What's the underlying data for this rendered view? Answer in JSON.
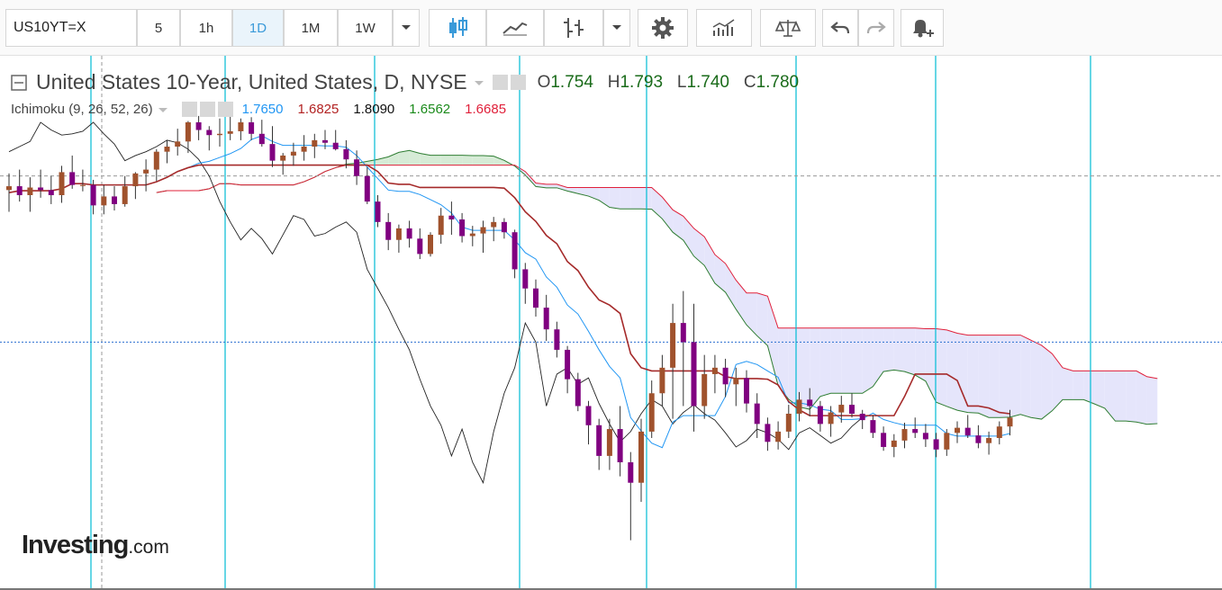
{
  "toolbar": {
    "symbol": "US10YT=X",
    "intervals": [
      {
        "label": "5",
        "active": false
      },
      {
        "label": "1h",
        "active": false
      },
      {
        "label": "1D",
        "active": true
      },
      {
        "label": "1M",
        "active": false
      },
      {
        "label": "1W",
        "active": false
      }
    ],
    "icons": [
      "chevron-down-icon",
      "candlestick-icon",
      "line-chart-icon",
      "bar-style-icon",
      "chevron-down-icon",
      "gear-icon",
      "indicators-icon",
      "compare-scale-icon",
      "undo-icon",
      "redo-icon",
      "alert-icon"
    ]
  },
  "legend": {
    "title": "United States 10-Year, United States, D, NYSE",
    "open_label": "O",
    "open": "1.754",
    "high_label": "H",
    "high": "1.793",
    "low_label": "L",
    "low": "1.740",
    "close_label": "C",
    "close": "1.780"
  },
  "indicator": {
    "name": "Ichimoku (9, 26, 52, 26)",
    "values": [
      "1.7650",
      "1.6825",
      "1.8090",
      "1.6562",
      "1.6685"
    ],
    "colors": [
      "#2196f3",
      "#a52a2a",
      "#111111",
      "#1a8a1a",
      "#e0203a"
    ]
  },
  "brand": {
    "name": "Investing",
    "suffix": ".com"
  },
  "colors": {
    "accent": "#3a9ad9",
    "candle_up": "#a0522d",
    "candle_down": "#800080",
    "tenkan": "#2196f3",
    "kijun": "#a52a2a",
    "chikou": "#222222",
    "span_a": "#2e7d32",
    "span_b": "#e0203a",
    "cloud_bull": "#cfe8cf",
    "cloud_bear": "#e0e0fa",
    "separator": "#00bcd4"
  },
  "chart_data": {
    "type": "candlestick",
    "indicator": "Ichimoku",
    "ylim": [
      1.49,
      1.87
    ],
    "current_price_line": 1.66,
    "crosshair_price": 1.79,
    "separator_count": 8,
    "candles": [
      [
        1.779,
        1.792,
        1.762,
        1.782
      ],
      [
        1.782,
        1.795,
        1.77,
        1.775
      ],
      [
        1.775,
        1.789,
        1.762,
        1.781
      ],
      [
        1.781,
        1.795,
        1.773,
        1.779
      ],
      [
        1.779,
        1.79,
        1.768,
        1.775
      ],
      [
        1.775,
        1.798,
        1.769,
        1.793
      ],
      [
        1.793,
        1.806,
        1.78,
        1.783
      ],
      [
        1.783,
        1.795,
        1.778,
        1.783
      ],
      [
        1.783,
        1.787,
        1.76,
        1.767
      ],
      [
        1.767,
        1.783,
        1.76,
        1.774
      ],
      [
        1.774,
        1.782,
        1.763,
        1.768
      ],
      [
        1.768,
        1.79,
        1.766,
        1.782
      ],
      [
        1.782,
        1.793,
        1.772,
        1.792
      ],
      [
        1.792,
        1.803,
        1.778,
        1.795
      ],
      [
        1.795,
        1.811,
        1.786,
        1.809
      ],
      [
        1.809,
        1.818,
        1.8,
        1.813
      ],
      [
        1.813,
        1.827,
        1.806,
        1.817
      ],
      [
        1.817,
        1.833,
        1.808,
        1.832
      ],
      [
        1.832,
        1.837,
        1.818,
        1.826
      ],
      [
        1.826,
        1.829,
        1.81,
        1.822
      ],
      [
        1.822,
        1.835,
        1.813,
        1.823
      ],
      [
        1.823,
        1.837,
        1.818,
        1.825
      ],
      [
        1.825,
        1.835,
        1.818,
        1.832
      ],
      [
        1.832,
        1.836,
        1.818,
        1.823
      ],
      [
        1.823,
        1.834,
        1.813,
        1.815
      ],
      [
        1.815,
        1.829,
        1.797,
        1.802
      ],
      [
        1.802,
        1.808,
        1.791,
        1.806
      ],
      [
        1.806,
        1.816,
        1.798,
        1.809
      ],
      [
        1.809,
        1.822,
        1.802,
        1.813
      ],
      [
        1.813,
        1.823,
        1.804,
        1.818
      ],
      [
        1.818,
        1.826,
        1.811,
        1.816
      ],
      [
        1.816,
        1.826,
        1.81,
        1.811
      ],
      [
        1.811,
        1.818,
        1.796,
        1.803
      ],
      [
        1.803,
        1.81,
        1.783,
        1.79
      ],
      [
        1.79,
        1.797,
        1.768,
        1.77
      ],
      [
        1.77,
        1.775,
        1.75,
        1.754
      ],
      [
        1.754,
        1.761,
        1.732,
        1.74
      ],
      [
        1.74,
        1.752,
        1.73,
        1.749
      ],
      [
        1.749,
        1.755,
        1.734,
        1.741
      ],
      [
        1.741,
        1.749,
        1.725,
        1.729
      ],
      [
        1.729,
        1.746,
        1.727,
        1.744
      ],
      [
        1.744,
        1.765,
        1.737,
        1.759
      ],
      [
        1.759,
        1.77,
        1.744,
        1.756
      ],
      [
        1.756,
        1.761,
        1.738,
        1.743
      ],
      [
        1.743,
        1.751,
        1.735,
        1.745
      ],
      [
        1.745,
        1.755,
        1.73,
        1.75
      ],
      [
        1.75,
        1.758,
        1.739,
        1.754
      ],
      [
        1.754,
        1.757,
        1.741,
        1.746
      ],
      [
        1.746,
        1.748,
        1.71,
        1.717
      ],
      [
        1.717,
        1.722,
        1.69,
        1.702
      ],
      [
        1.702,
        1.709,
        1.68,
        1.687
      ],
      [
        1.687,
        1.697,
        1.661,
        1.67
      ],
      [
        1.67,
        1.676,
        1.648,
        1.654
      ],
      [
        1.654,
        1.657,
        1.62,
        1.631
      ],
      [
        1.631,
        1.636,
        1.606,
        1.61
      ],
      [
        1.61,
        1.614,
        1.58,
        1.595
      ],
      [
        1.595,
        1.6,
        1.56,
        1.571
      ],
      [
        1.571,
        1.6,
        1.56,
        1.592
      ],
      [
        1.592,
        1.61,
        1.555,
        1.566
      ],
      [
        1.566,
        1.574,
        1.505,
        1.55
      ],
      [
        1.55,
        1.6,
        1.535,
        1.59
      ],
      [
        1.59,
        1.63,
        1.585,
        1.62
      ],
      [
        1.62,
        1.65,
        1.61,
        1.64
      ],
      [
        1.64,
        1.69,
        1.6,
        1.675
      ],
      [
        1.675,
        1.7,
        1.61,
        1.66
      ],
      [
        1.66,
        1.69,
        1.59,
        1.61
      ],
      [
        1.61,
        1.65,
        1.6,
        1.635
      ],
      [
        1.635,
        1.65,
        1.62,
        1.64
      ],
      [
        1.64,
        1.647,
        1.617,
        1.627
      ],
      [
        1.627,
        1.64,
        1.61,
        1.632
      ],
      [
        1.632,
        1.638,
        1.605,
        1.612
      ],
      [
        1.612,
        1.62,
        1.585,
        1.596
      ],
      [
        1.596,
        1.601,
        1.575,
        1.582
      ],
      [
        1.582,
        1.598,
        1.576,
        1.59
      ],
      [
        1.59,
        1.611,
        1.585,
        1.604
      ],
      [
        1.604,
        1.621,
        1.598,
        1.615
      ],
      [
        1.615,
        1.624,
        1.602,
        1.61
      ],
      [
        1.61,
        1.614,
        1.59,
        1.596
      ],
      [
        1.596,
        1.61,
        1.586,
        1.605
      ],
      [
        1.605,
        1.618,
        1.597,
        1.611
      ],
      [
        1.611,
        1.62,
        1.601,
        1.604
      ],
      [
        1.604,
        1.607,
        1.592,
        1.599
      ],
      [
        1.599,
        1.603,
        1.585,
        1.589
      ],
      [
        1.589,
        1.594,
        1.575,
        1.578
      ],
      [
        1.578,
        1.588,
        1.57,
        1.583
      ],
      [
        1.583,
        1.597,
        1.577,
        1.592
      ],
      [
        1.592,
        1.601,
        1.585,
        1.589
      ],
      [
        1.589,
        1.596,
        1.578,
        1.584
      ],
      [
        1.584,
        1.589,
        1.57,
        1.576
      ],
      [
        1.576,
        1.592,
        1.571,
        1.589
      ],
      [
        1.589,
        1.598,
        1.581,
        1.593
      ],
      [
        1.593,
        1.603,
        1.585,
        1.587
      ],
      [
        1.587,
        1.595,
        1.577,
        1.581
      ],
      [
        1.581,
        1.59,
        1.572,
        1.585
      ],
      [
        1.585,
        1.598,
        1.58,
        1.594
      ],
      [
        1.594,
        1.607,
        1.587,
        1.601
      ]
    ]
  }
}
